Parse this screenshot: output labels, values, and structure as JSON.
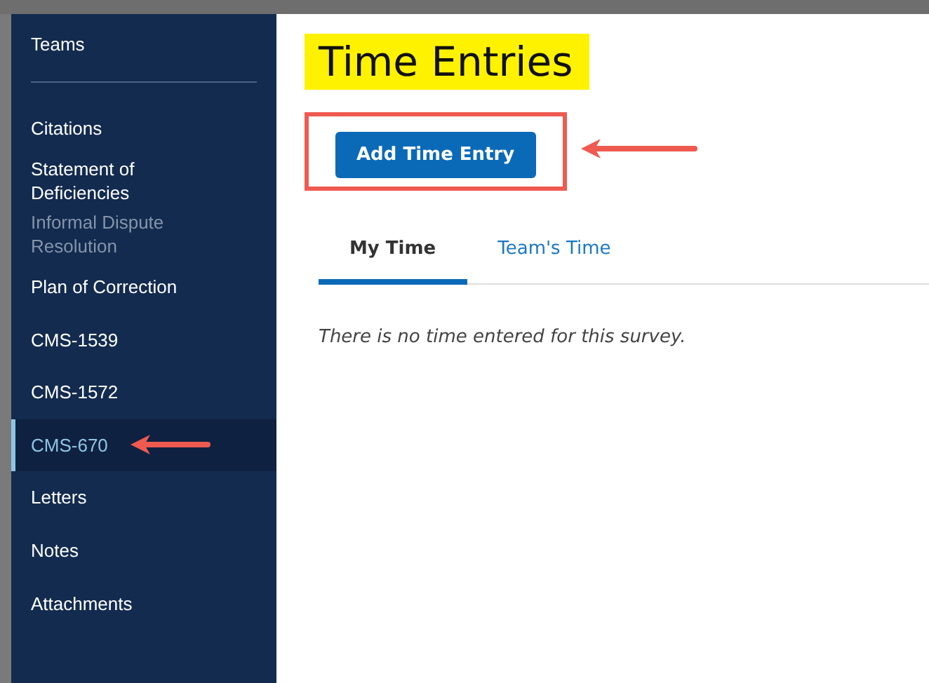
{
  "sidebar": {
    "header": "Teams",
    "items": [
      {
        "label": "Citations",
        "selected": false,
        "disabled": false
      },
      {
        "label": "Statement of Deficiencies",
        "selected": false,
        "disabled": false
      },
      {
        "label": "Informal Dispute Resolution",
        "selected": false,
        "disabled": true
      },
      {
        "label": "Plan of Correction",
        "selected": false,
        "disabled": false
      },
      {
        "label": "CMS-1539",
        "selected": false,
        "disabled": false
      },
      {
        "label": "CMS-1572",
        "selected": false,
        "disabled": false
      },
      {
        "label": "CMS-670",
        "selected": true,
        "disabled": false
      },
      {
        "label": "Letters",
        "selected": false,
        "disabled": false
      },
      {
        "label": "Notes",
        "selected": false,
        "disabled": false
      },
      {
        "label": "Attachments",
        "selected": false,
        "disabled": false
      }
    ]
  },
  "page": {
    "title": "Time Entries",
    "add_button": "Add Time Entry",
    "tabs": [
      {
        "label": "My Time",
        "selected": true
      },
      {
        "label": "Team's Time",
        "selected": false
      }
    ],
    "empty_message": "There is no time entered for this survey."
  }
}
